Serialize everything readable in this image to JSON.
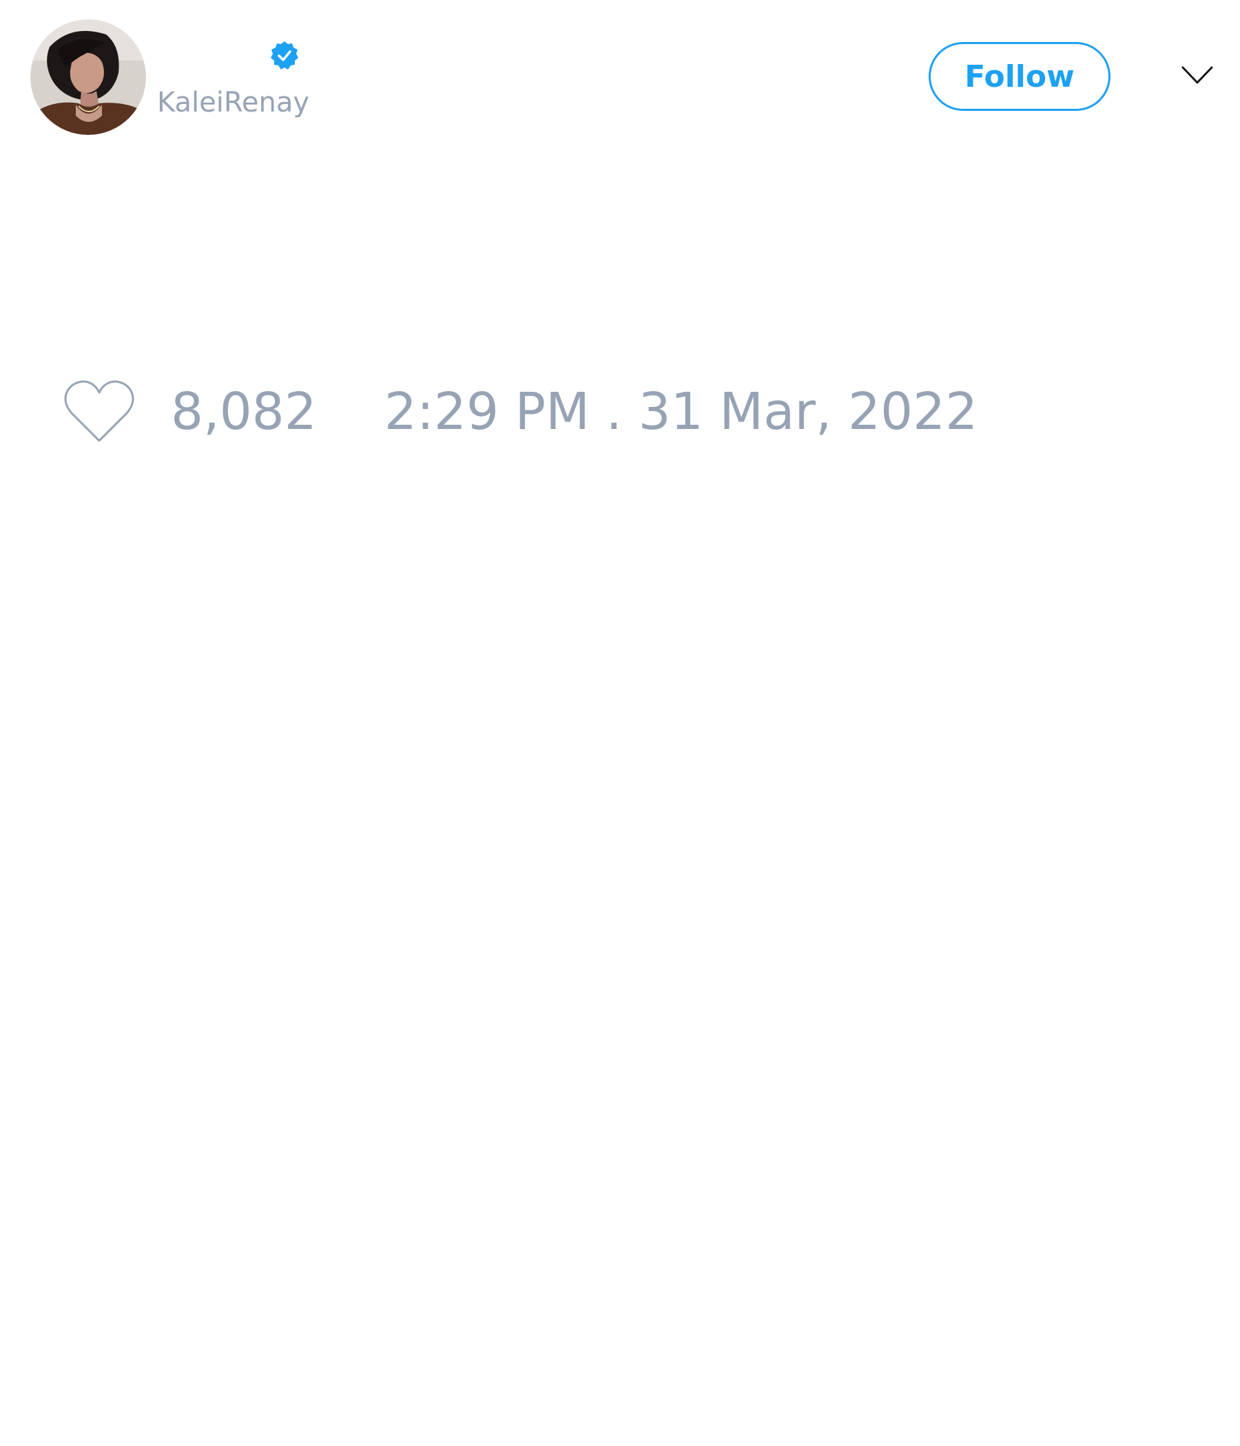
{
  "tweet": {
    "author": {
      "display_name": "",
      "handle": "KaleiRenay",
      "verified": true,
      "avatar_icon": "profile-photo"
    },
    "follow_label": "Follow",
    "menu_icon": "chevron-down-icon",
    "like_icon": "heart-icon",
    "like_count": "8,082",
    "timestamp": "2:29 PM . 31 Mar, 2022"
  },
  "colors": {
    "accent": "#1da1f2",
    "muted_text": "#97a3b5",
    "background": "#ffffff"
  }
}
